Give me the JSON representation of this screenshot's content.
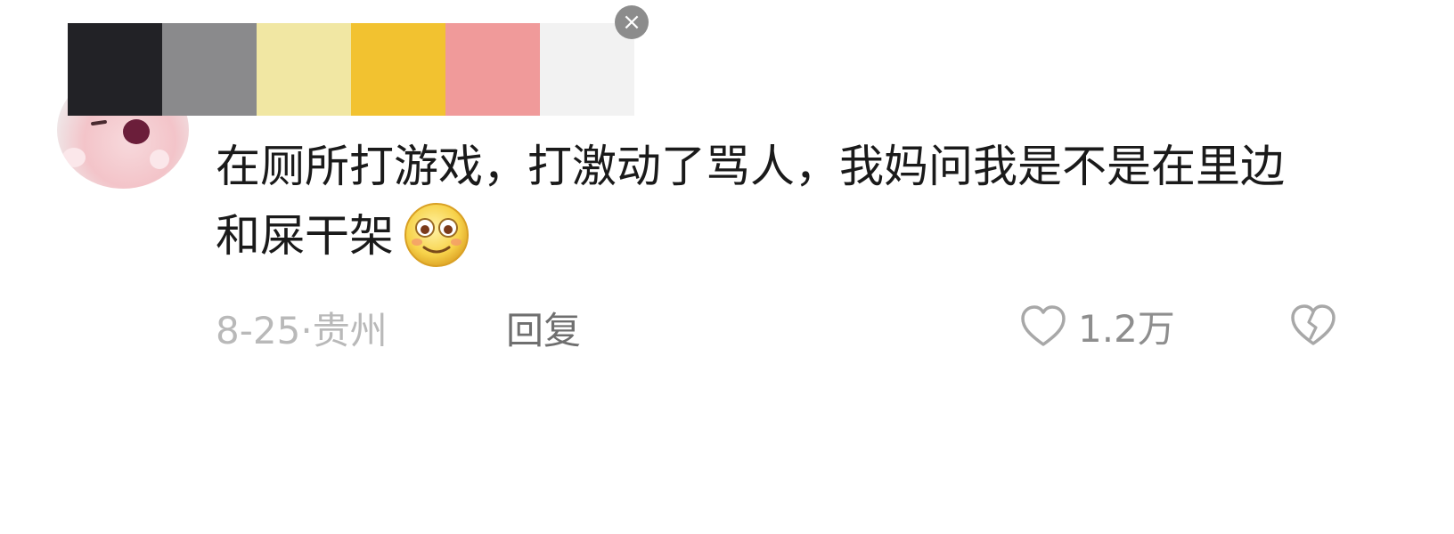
{
  "palette": {
    "colors": [
      "#222226",
      "#8a8a8c",
      "#f1e7a3",
      "#f2c230",
      "#f09a9a",
      "#f2f2f2"
    ],
    "close_icon": "×"
  },
  "avatar": {
    "icon": "pink-cartoon-beaver-avatar"
  },
  "comment": {
    "text": "在厕所打游戏，打激动了骂人，我妈问我是不是在里边和屎干架",
    "emoji": "smiling-blushing-face-emoji"
  },
  "meta": {
    "date": "8-25",
    "separator": "·",
    "location": "贵州"
  },
  "actions": {
    "reply_label": "回复",
    "like_count": "1.2万",
    "like_icon": "heart-outline-icon",
    "dislike_icon": "broken-heart-icon"
  }
}
